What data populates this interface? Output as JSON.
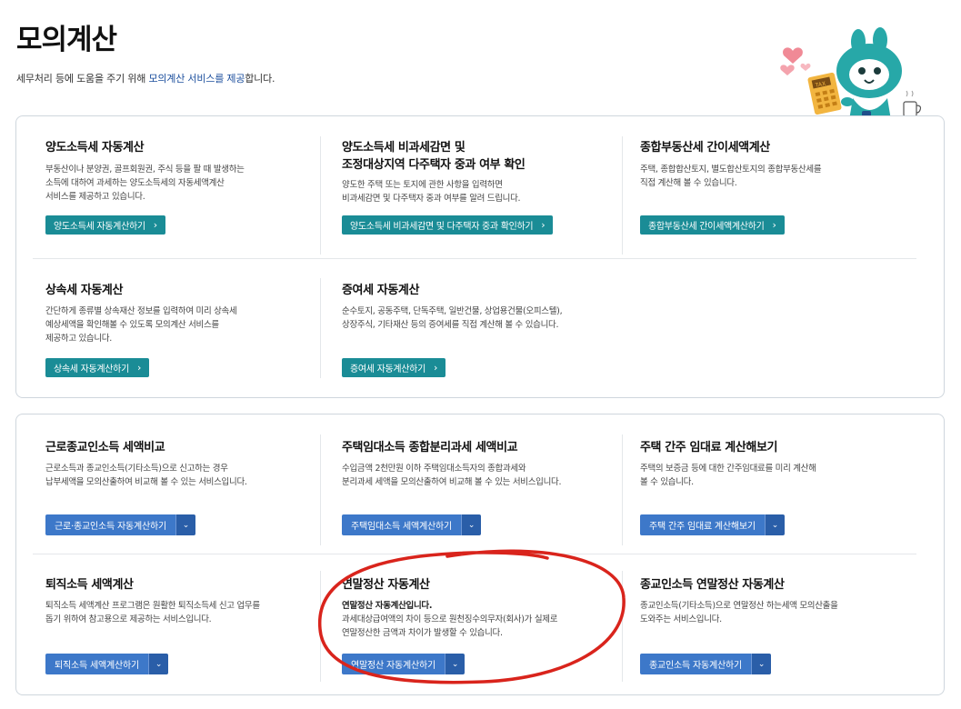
{
  "header": {
    "title": "모의계산",
    "subtitle_prefix": "세무처리 등에 도움을 주기 위해 ",
    "subtitle_highlight": "모의계산 서비스를 제공",
    "subtitle_suffix": "합니다."
  },
  "section1": [
    {
      "title": "양도소득세 자동계산",
      "desc": [
        "부동산이나 분양권, 골프회원권, 주식 등을 팔 때 발생하는",
        "소득에 대하여 과세하는 양도소득세의 자동세액계산",
        "서비스를 제공하고 있습니다."
      ],
      "button": "양도소득세 자동계산하기"
    },
    {
      "title_lines": [
        "양도소득세 비과세감면 및",
        "조정대상지역 다주택자 중과 여부 확인"
      ],
      "desc": [
        "양도한 주택 또는 토지에 관한 사항을 입력하면",
        "비과세감면 및 다주택자 중과 여부를 알려 드립니다."
      ],
      "button": "양도소득세 비과세감면 및 다주택자 중과 확인하기"
    },
    {
      "title": "종합부동산세 간이세액계산",
      "desc": [
        "주택, 종합합산토지, 별도합산토지의 종합부동산세를",
        "직접 계산해 볼 수 있습니다."
      ],
      "button": "종합부동산세 간이세액계산하기"
    },
    {
      "title": "상속세 자동계산",
      "desc": [
        "간단하게 종류별 상속재산 정보를 입력하여 미리 상속세",
        "예상세액을 확인해볼 수 있도록 모의계산 서비스를",
        "제공하고 있습니다."
      ],
      "button": "상속세 자동계산하기"
    },
    {
      "title": "증여세 자동계산",
      "desc": [
        "순수토지, 공동주택, 단독주택, 일반건물, 상업용건물(오피스텔),",
        "상장주식, 기타재산 등의 증여세를 직접 계산해 볼 수 있습니다."
      ],
      "button": "증여세 자동계산하기"
    }
  ],
  "section2": [
    {
      "title": "근로종교인소득 세액비교",
      "desc": [
        "근로소득과 종교인소득(기타소득)으로 신고하는 경우",
        "납부세액을 모의산출하여 비교해 볼 수 있는 서비스입니다."
      ],
      "button": "근로·종교인소득 자동계산하기"
    },
    {
      "title": "주택임대소득 종합분리과세 세액비교",
      "desc": [
        "수입금액 2천만원 이하 주택임대소득자의 종합과세와",
        "분리과세 세액을 모의산출하여 비교해 볼 수 있는 서비스입니다."
      ],
      "button": "주택임대소득 세액계산하기"
    },
    {
      "title": "주택 간주 임대료 계산해보기",
      "desc": [
        "주택의 보증금 등에 대한 간주임대료를 미리 계산해",
        "볼 수 있습니다."
      ],
      "button": "주택 간주 임대료 계산해보기"
    },
    {
      "title": "퇴직소득 세액계산",
      "desc": [
        "퇴직소득 세액계산 프로그램은 원활한 퇴직소득세 신고 업무를",
        "돕기 위하여 참고용으로 제공하는 서비스입니다."
      ],
      "button": "퇴직소득 세액계산하기"
    },
    {
      "title": "연말정산 자동계산",
      "desc_bold": "연말정산 자동계산입니다.",
      "desc": [
        "과세대상급여액의 차이 등으로 원천징수의무자(회사)가 실제로",
        "연말정산한 금액과 차이가 발생할 수 있습니다."
      ],
      "button": "연말정산 자동계산하기"
    },
    {
      "title": "종교인소득 연말정산 자동계산",
      "desc": [
        "종교인소득(기타소득)으로 연말정산 하는세액 모의산출을",
        "도와주는 서비스입니다."
      ],
      "button": "종교인소득 자동계산하기"
    }
  ],
  "icons": {
    "chevron": "›",
    "dropdown": "⌄"
  },
  "colors": {
    "teal_button": "#1a8c96",
    "blue_button": "#3d78c9",
    "annotation": "#d9241c",
    "mascot": "#27a8a8"
  }
}
